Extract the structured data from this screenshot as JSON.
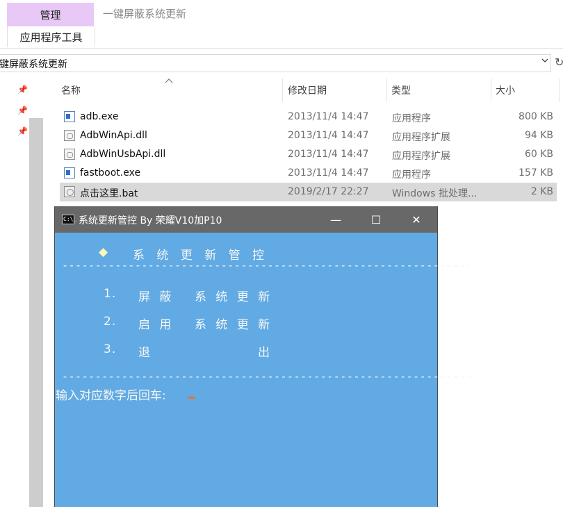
{
  "ribbon": {
    "context_tab": "管理",
    "context_sub": "应用程序工具",
    "window_title": "一键屏蔽系统更新"
  },
  "address": {
    "path": "键屏蔽系统更新",
    "dropdown_icon": "chevron-down-icon",
    "refresh_icon": "refresh-icon"
  },
  "columns": {
    "name": "名称",
    "date": "修改日期",
    "type": "类型",
    "size": "大小"
  },
  "files": [
    {
      "name": "adb.exe",
      "date": "2013/11/4 14:47",
      "type": "应用程序",
      "size": "800 KB",
      "icon": "exe-file-icon"
    },
    {
      "name": "AdbWinApi.dll",
      "date": "2013/11/4 14:47",
      "type": "应用程序扩展",
      "size": "94 KB",
      "icon": "dll-file-icon"
    },
    {
      "name": "AdbWinUsbApi.dll",
      "date": "2013/11/4 14:47",
      "type": "应用程序扩展",
      "size": "60 KB",
      "icon": "dll-file-icon"
    },
    {
      "name": "fastboot.exe",
      "date": "2013/11/4 14:47",
      "type": "应用程序",
      "size": "157 KB",
      "icon": "exe-file-icon"
    },
    {
      "name": "点击这里.bat",
      "date": "2019/2/17 22:27",
      "type": "Windows 批处理...",
      "size": "2 KB",
      "icon": "bat-file-icon",
      "selected": true
    }
  ],
  "console": {
    "title": "系统更新管控 By 荣耀V10加P10",
    "icon_text": "C:\\_",
    "minimize": "—",
    "maximize": "☐",
    "close": "✕",
    "diamond": "◆",
    "heading": "系 统 更 新 管 控",
    "separator": "--------------------------------------------------------------",
    "menu": [
      {
        "num": "1.",
        "text": "屏 蔽",
        "text2": "系 统 更 新"
      },
      {
        "num": "2.",
        "text": "启 用",
        "text2": "系 统 更 新"
      },
      {
        "num": "3.",
        "text": "退",
        "text2": "出"
      }
    ],
    "prompt": "输入对应数字后回车:"
  }
}
